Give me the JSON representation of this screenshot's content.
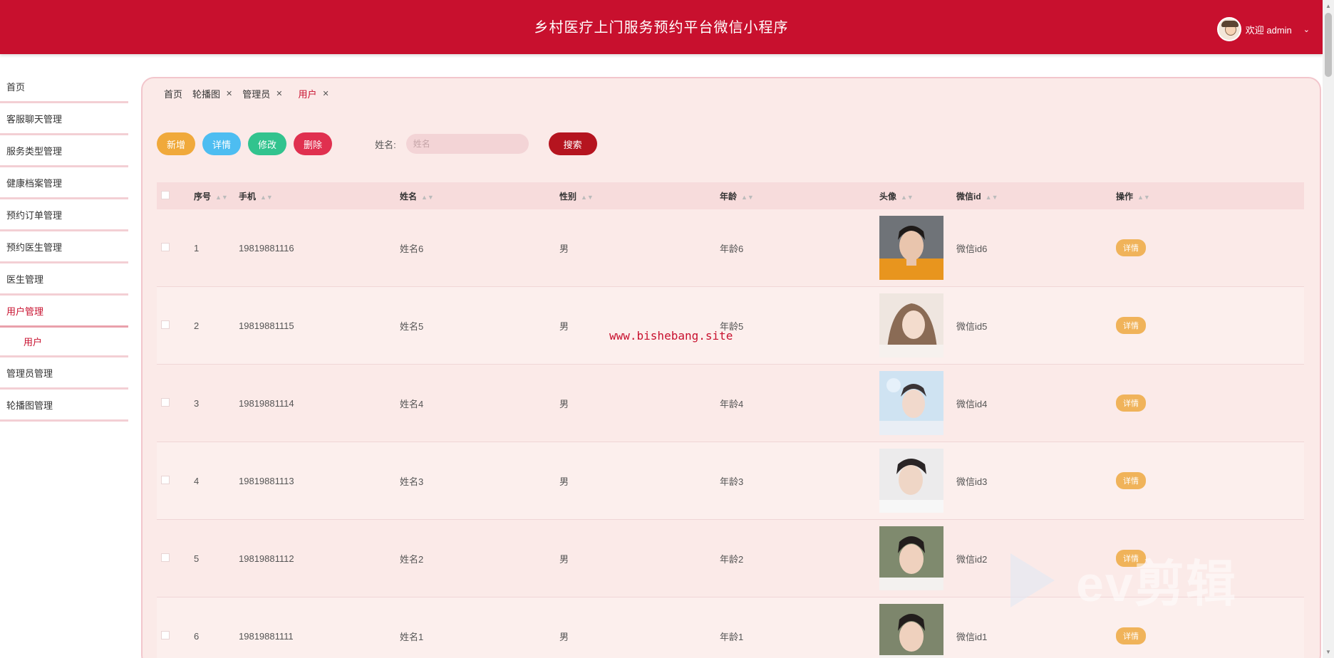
{
  "header": {
    "title": "乡村医疗上门服务预约平台微信小程序",
    "welcome": "欢迎 admin"
  },
  "sidebar": {
    "items": [
      {
        "label": "首页"
      },
      {
        "label": "客服聊天管理"
      },
      {
        "label": "服务类型管理"
      },
      {
        "label": "健康档案管理"
      },
      {
        "label": "预约订单管理"
      },
      {
        "label": "预约医生管理"
      },
      {
        "label": "医生管理"
      },
      {
        "label": "用户管理"
      },
      {
        "label": "管理员管理"
      },
      {
        "label": "轮播图管理"
      }
    ],
    "sub_item": "用户"
  },
  "tabs": [
    {
      "label": "首页"
    },
    {
      "label": "轮播图"
    },
    {
      "label": "管理员"
    },
    {
      "label": "用户"
    }
  ],
  "toolbar": {
    "add": "新增",
    "detail": "详情",
    "edit": "修改",
    "delete": "删除",
    "search_label": "姓名:",
    "search_placeholder": "姓名",
    "search_button": "搜索"
  },
  "table": {
    "columns": [
      "序号",
      "手机",
      "姓名",
      "性别",
      "年龄",
      "头像",
      "微信id",
      "操作"
    ],
    "rows": [
      {
        "no": "1",
        "phone": "19819881116",
        "name": "姓名6",
        "gender": "男",
        "age": "年龄6",
        "wx": "微信id6",
        "op": "详情"
      },
      {
        "no": "2",
        "phone": "19819881115",
        "name": "姓名5",
        "gender": "男",
        "age": "年龄5",
        "wx": "微信id5",
        "op": "详情"
      },
      {
        "no": "3",
        "phone": "19819881114",
        "name": "姓名4",
        "gender": "男",
        "age": "年龄4",
        "wx": "微信id4",
        "op": "详情"
      },
      {
        "no": "4",
        "phone": "19819881113",
        "name": "姓名3",
        "gender": "男",
        "age": "年龄3",
        "wx": "微信id3",
        "op": "详情"
      },
      {
        "no": "5",
        "phone": "19819881112",
        "name": "姓名2",
        "gender": "男",
        "age": "年龄2",
        "wx": "微信id2",
        "op": "详情"
      },
      {
        "no": "6",
        "phone": "19819881111",
        "name": "姓名1",
        "gender": "男",
        "age": "年龄1",
        "wx": "微信id1",
        "op": "详情"
      }
    ]
  },
  "watermark": "www.bishebang.site",
  "overlay_logo": "ev剪辑",
  "colors": {
    "primary": "#c8102e",
    "panel_bg": "#fbeae8",
    "add": "#f0a93b",
    "detail": "#4dbdf1",
    "edit": "#32c38e",
    "delete": "#e0304f"
  }
}
